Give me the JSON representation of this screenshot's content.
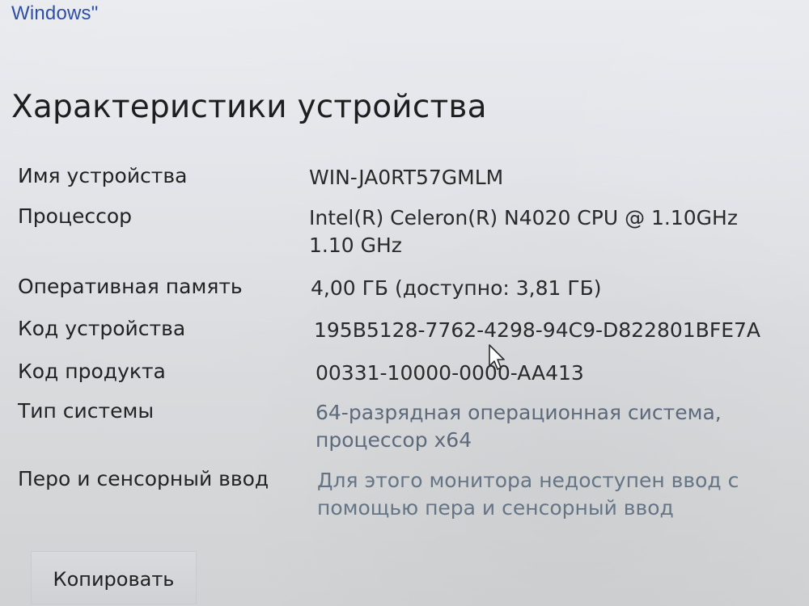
{
  "header": {
    "top_link": "Windows\"",
    "title": "Характеристики устройства"
  },
  "device_specs": {
    "rows": [
      {
        "label": "Имя устройства",
        "value": "WIN-JA0RT57GMLM"
      },
      {
        "label": "Процессор",
        "value": "Intel(R) Celeron(R) N4020 CPU @ 1.10GHz\n1.10 GHz"
      },
      {
        "label": "Оперативная память",
        "value": "4,00 ГБ (доступно: 3,81 ГБ)"
      },
      {
        "label": "Код устройства",
        "value": "195B5128-7762-4298-94C9-D822801BFE7A"
      },
      {
        "label": "Код продукта",
        "value": "00331-10000-0000-AA413"
      },
      {
        "label": "Тип системы",
        "value": "64-разрядная операционная система,\nпроцессор x64"
      },
      {
        "label": "Перо и сенсорный ввод",
        "value": "Для этого монитора недоступен ввод с\nпомощью пера и сенсорный ввод"
      }
    ]
  },
  "actions": {
    "copy_label": "Копировать"
  },
  "icons": {
    "cursor": "mouse-pointer-icon"
  }
}
